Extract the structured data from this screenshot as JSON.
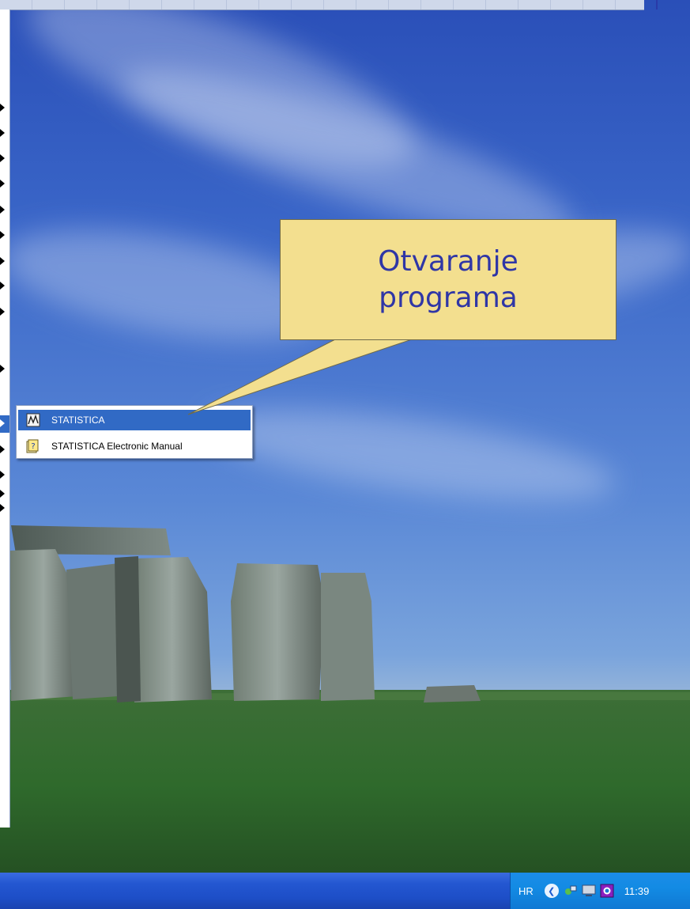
{
  "submenu": {
    "items": [
      {
        "label": "STATISTICA",
        "icon": "statistica-app-icon",
        "selected": true
      },
      {
        "label": "STATISTICA Electronic Manual",
        "icon": "help-manual-icon",
        "selected": false
      }
    ]
  },
  "callout": {
    "text": "Otvaranje programa"
  },
  "taskbar": {
    "language": "HR",
    "clock": "11:39",
    "tray_icons": [
      "chevron-left-icon",
      "network-icon",
      "monitor-icon",
      "app-tray-icon"
    ]
  },
  "colors": {
    "selection": "#316ac5",
    "callout_fill": "#f3df8f",
    "callout_text": "#2f36a6",
    "taskbar": "#2457d1",
    "tray": "#138be4"
  }
}
